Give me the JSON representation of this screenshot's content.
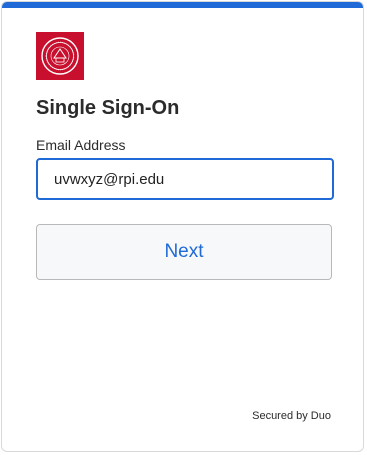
{
  "login": {
    "title": "Single Sign-On",
    "email_label": "Email Address",
    "email_value": "uvwxyz@rpi.edu",
    "next_label": "Next",
    "secured_text": "Secured by Duo"
  },
  "colors": {
    "accent": "#1f6ad6",
    "logo_red": "#c8102e"
  },
  "icons": {
    "logo": "rpi-seal-logo"
  }
}
